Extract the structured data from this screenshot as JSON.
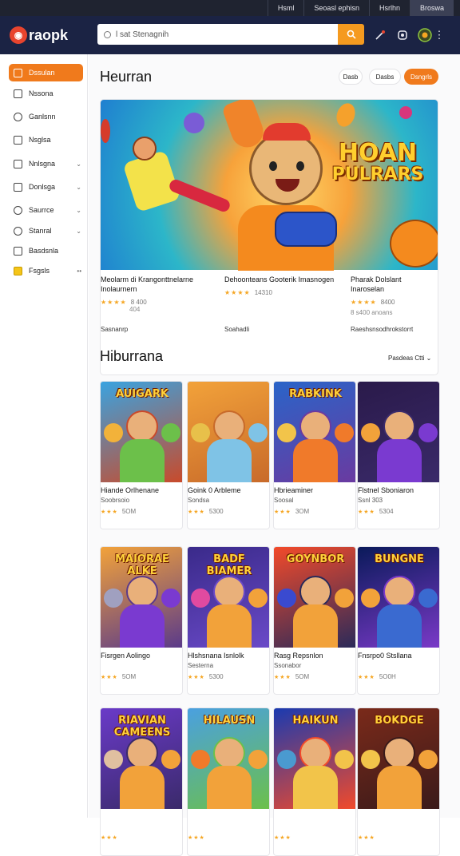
{
  "topbar": {
    "links": [
      "Hsml",
      "Seoasl ephisn",
      "Hsrlhn",
      "Broswa"
    ]
  },
  "header": {
    "logo": "raopk",
    "search_placeholder": "l sat Stenagnih"
  },
  "sidebar": {
    "items": [
      {
        "label": "Dssulan"
      },
      {
        "label": "Nssona"
      },
      {
        "label": "Ganlsnn"
      },
      {
        "label": "Nsglsa"
      },
      {
        "label": "Nnlsgna"
      },
      {
        "label": "Donlsga"
      },
      {
        "label": "Saurrce"
      },
      {
        "label": "Stanral"
      },
      {
        "label": "Basdsnla"
      },
      {
        "label": "Fsgsls"
      }
    ]
  },
  "main": {
    "title": "Heurran",
    "filters": [
      "Dasb",
      "Dasbs",
      "Dsngrls"
    ],
    "featured": {
      "art_title_lines": [
        "HOAN",
        "PULRARS"
      ],
      "cols": [
        {
          "title": "Meolarm di Krangonttnelarne Inolaurnern",
          "stars": "★★★★",
          "count": "8 400",
          "small": "404",
          "footer": "Sasnanrp"
        },
        {
          "title": "Dehoonteans Gooterik Imasnogen",
          "stars": "★★★★",
          "count": "14310",
          "small": "",
          "footer": "Soahadli"
        },
        {
          "title": "Pharak Dolslant Inaroselan",
          "stars": "★★★★",
          "count": "8400",
          "small": "8 s400 anoans",
          "footer": "Raeshsnsodhrokstorrt"
        }
      ]
    },
    "section_title": "Hiburrana",
    "sort_label": "Pasdeas Ctti",
    "games": [
      {
        "art": "AUIGARK",
        "name": "Hiande Orlhenane",
        "sub": "Soobrsoio",
        "rating": "5OM"
      },
      {
        "art": "",
        "name": "Goink 0 Arbleme",
        "sub": "Sondsa",
        "rating": "5300"
      },
      {
        "art": "RABKINK",
        "name": "Hbrieaminer",
        "sub": "Soosal",
        "rating": "3OM"
      },
      {
        "art": "",
        "name": "Flstnel Sboniaron",
        "sub": "Ssnl 303",
        "rating": "5304"
      },
      {
        "art": "MAIORAE ALKE",
        "name": "Fisrgen Aolingo",
        "sub": "",
        "rating": "5OM"
      },
      {
        "art": "BADF BIAMER",
        "name": "Hlshsnana Isnlolk",
        "sub": "Sesterna",
        "rating": "5300"
      },
      {
        "art": "GOYNBOR",
        "name": "Rasg Repsnlon",
        "sub": "Ssonabor",
        "rating": "5OM"
      },
      {
        "art": "BUNGNE",
        "name": "Fnsrpo0 Stsllana",
        "sub": "",
        "rating": "5O0H"
      },
      {
        "art": "RIAVIAN CAMEENS",
        "name": "",
        "sub": "",
        "rating": ""
      },
      {
        "art": "HILAUSN",
        "name": "",
        "sub": "",
        "rating": ""
      },
      {
        "art": "HAIKUN",
        "name": "",
        "sub": "",
        "rating": ""
      },
      {
        "art": "BOKDGE",
        "name": "",
        "sub": "",
        "rating": ""
      }
    ]
  },
  "colors": {
    "accent": "#f07a1c",
    "header": "#1b2344",
    "search_button": "#f59a1f"
  }
}
